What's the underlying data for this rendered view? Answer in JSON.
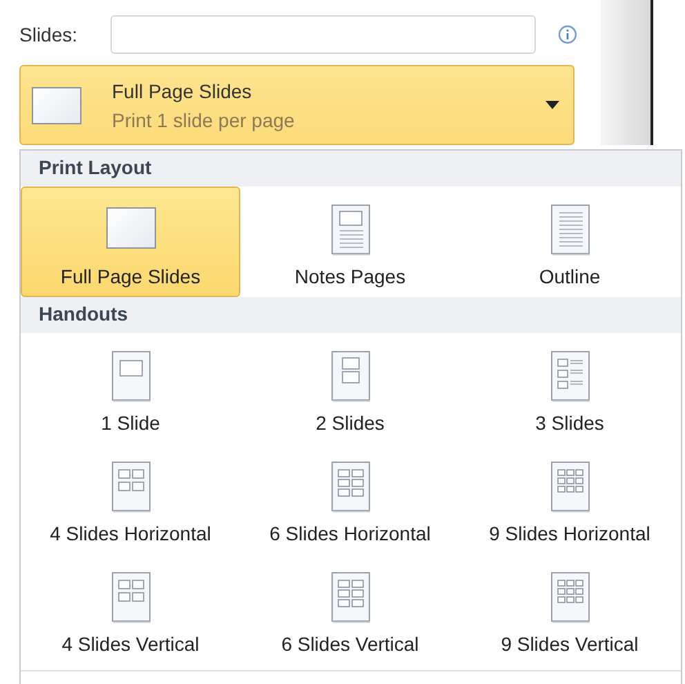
{
  "slides_field": {
    "label": "Slides:"
  },
  "layout_dropdown": {
    "title": "Full Page Slides",
    "subtitle": "Print 1 slide per page"
  },
  "sections": [
    {
      "title": "Print Layout",
      "items": [
        {
          "label": "Full Page Slides",
          "kind": "full",
          "selected": true
        },
        {
          "label": "Notes Pages",
          "kind": "notes",
          "selected": false
        },
        {
          "label": "Outline",
          "kind": "outline",
          "selected": false
        }
      ]
    },
    {
      "title": "Handouts",
      "items": [
        {
          "label": "1 Slide",
          "kind": "one",
          "selected": false
        },
        {
          "label": "2 Slides",
          "kind": "two",
          "selected": false
        },
        {
          "label": "3 Slides",
          "kind": "three",
          "selected": false
        },
        {
          "label": "4 Slides Horizontal",
          "kind": "four",
          "selected": false
        },
        {
          "label": "6 Slides Horizontal",
          "kind": "six",
          "selected": false
        },
        {
          "label": "9 Slides Horizontal",
          "kind": "nine",
          "selected": false
        },
        {
          "label": "4 Slides Vertical",
          "kind": "four",
          "selected": false
        },
        {
          "label": "6 Slides Vertical",
          "kind": "six",
          "selected": false
        },
        {
          "label": "9 Slides Vertical",
          "kind": "nine",
          "selected": false
        }
      ]
    }
  ]
}
